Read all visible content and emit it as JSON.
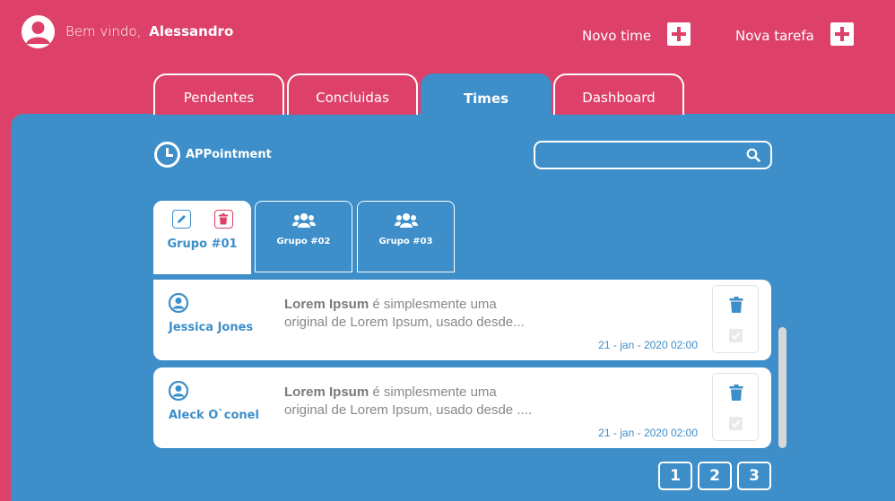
{
  "header": {
    "welcome_text": "Bem vindo,",
    "user_name": "Alessandro",
    "new_team_label": "Novo time",
    "new_task_label": "Nova tarefa"
  },
  "tabs": [
    {
      "label": "Pendentes"
    },
    {
      "label": "Concluidas"
    },
    {
      "label": "Times"
    },
    {
      "label": "Dashboard"
    }
  ],
  "brand": {
    "name": "APPointment"
  },
  "search": {
    "placeholder": "",
    "value": ""
  },
  "groups": [
    {
      "label": "Grupo #01",
      "active": true
    },
    {
      "label": "Grupo #02"
    },
    {
      "label": "Grupo #03"
    }
  ],
  "cards": [
    {
      "person": "Jessica Jones",
      "title": "Lorem Ipsum",
      "text_1": " é simplesmente uma",
      "text_2": "original de Lorem Ipsum, usado desde...",
      "date": "21 - jan - 2020 02:00"
    },
    {
      "person": "Aleck O`conel",
      "title": "Lorem Ipsum",
      "text_1": " é simplesmente uma",
      "text_2": "original de Lorem Ipsum, usado desde ....",
      "date": "21 - jan - 2020 02:00"
    }
  ],
  "pagination": [
    "1",
    "2",
    "3"
  ],
  "colors": {
    "primary": "#dd4068",
    "secondary": "#3d8ec9",
    "white": "#ffffff"
  }
}
